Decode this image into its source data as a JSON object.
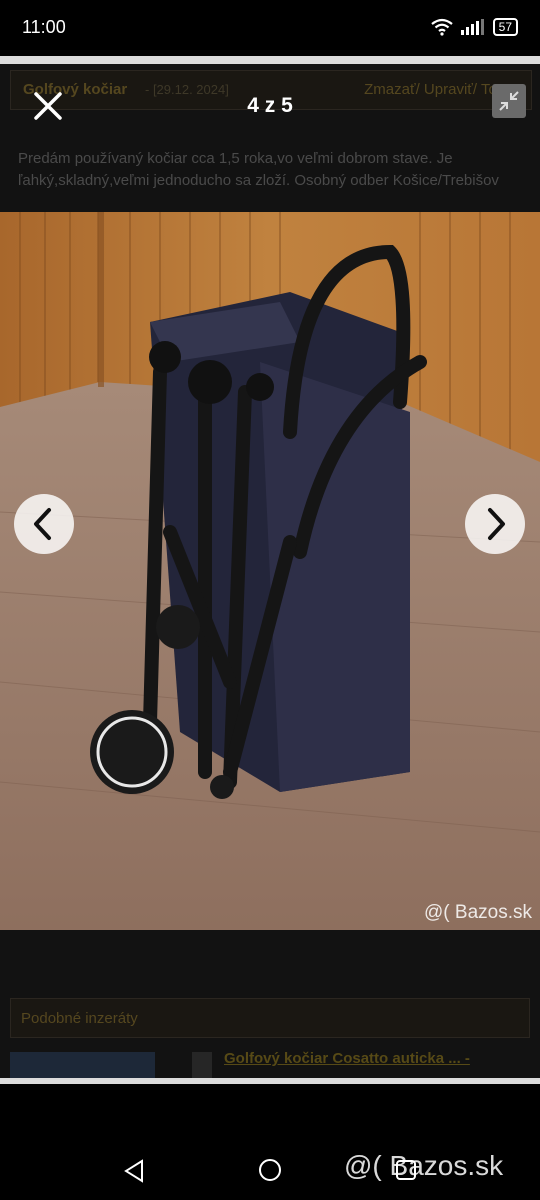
{
  "status_bar": {
    "time": "11:00",
    "battery": "57",
    "wifi_icon": "wifi-icon",
    "signal_icon": "signal-icon"
  },
  "viewer": {
    "counter": "4 z 5",
    "close_icon": "close-icon",
    "fullscreen_icon": "collapse-icon",
    "prev_icon": "chevron-left-icon",
    "next_icon": "chevron-right-icon",
    "current_index": 4,
    "total": 5
  },
  "listing": {
    "title": "Golfový kočiar",
    "date": "- [29.12. 2024]",
    "actions": "Zmazať/ Upraviť/ Topov",
    "description": "Predám používaný kočiar cca 1,5 roka,vo veľmi dobrom stave. Je ľahký,skladný,veľmi jednoducho sa zloží. Osobný odber Košice/Trebišov"
  },
  "photo": {
    "watermark": "@( Bazos.sk"
  },
  "similar": {
    "heading": "Podobné inzeráty",
    "first_link": "Golfový kočiar Cosatto auticka ... -"
  },
  "navbar": {
    "brand": "@( Bazos.sk",
    "back_icon": "back-triangle-icon",
    "home_icon": "home-circle-icon",
    "recents_icon": "recents-square-icon"
  },
  "colors": {
    "background": "#000000",
    "dim_text": "#55471f",
    "overlay_button": "#ffffff"
  }
}
